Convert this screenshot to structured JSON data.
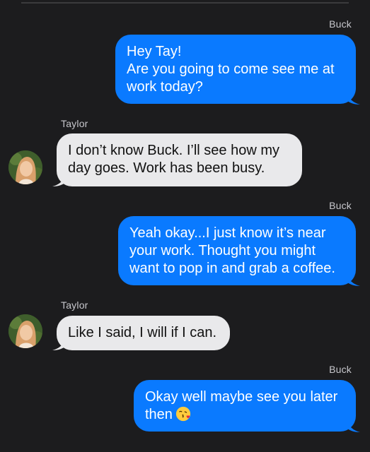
{
  "conversation": {
    "messages": [
      {
        "sender": "Buck",
        "direction": "sent",
        "lines": [
          "Hey Tay!",
          "Are you going to come see me at",
          "work today?"
        ]
      },
      {
        "sender": "Taylor",
        "direction": "received",
        "lines": [
          "I don’t know Buck. I’ll see how my",
          "day goes. Work has been busy."
        ]
      },
      {
        "sender": "Buck",
        "direction": "sent",
        "lines": [
          "Yeah okay...I just know it’s near",
          "your work. Thought you might",
          "want to pop in and grab a coffee."
        ]
      },
      {
        "sender": "Taylor",
        "direction": "received",
        "lines": [
          "Like I said, I will if I can."
        ]
      },
      {
        "sender": "Buck",
        "direction": "sent",
        "lines": [
          "Okay well maybe see you later",
          "then"
        ],
        "trailing_emoji": "face-blowing-a-kiss-icon"
      }
    ]
  },
  "colors": {
    "background": "#1c1c1e",
    "sent_bubble": "#0a7aff",
    "received_bubble": "#e9e9eb",
    "sender_label": "#c7c7cc"
  }
}
